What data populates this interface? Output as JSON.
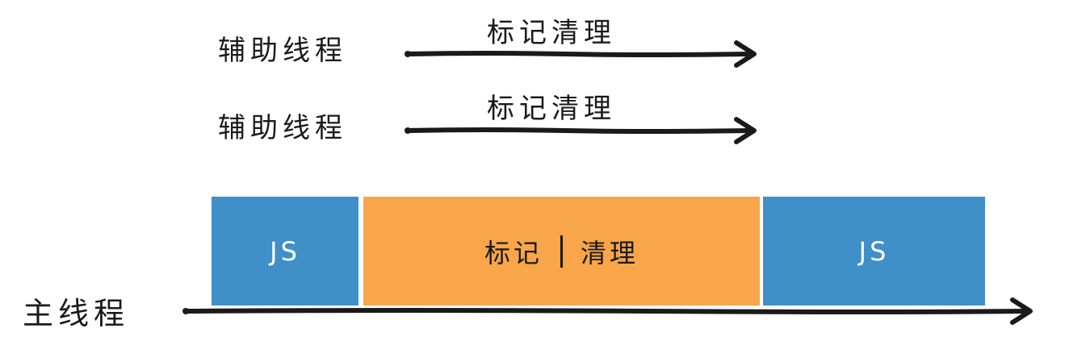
{
  "helper_threads": [
    {
      "thread_label": "辅助线程",
      "task_label": "标记清理"
    },
    {
      "thread_label": "辅助线程",
      "task_label": "标记清理"
    }
  ],
  "main_thread": {
    "label": "主线程",
    "blocks": [
      {
        "kind": "js",
        "label": "JS"
      },
      {
        "kind": "gc",
        "label_left": "标记",
        "label_right": "清理"
      },
      {
        "kind": "js",
        "label": "JS"
      }
    ]
  },
  "colors": {
    "js_block": "#3f8fc8",
    "gc_block": "#f8a649",
    "arrow": "#1a1a1a"
  }
}
